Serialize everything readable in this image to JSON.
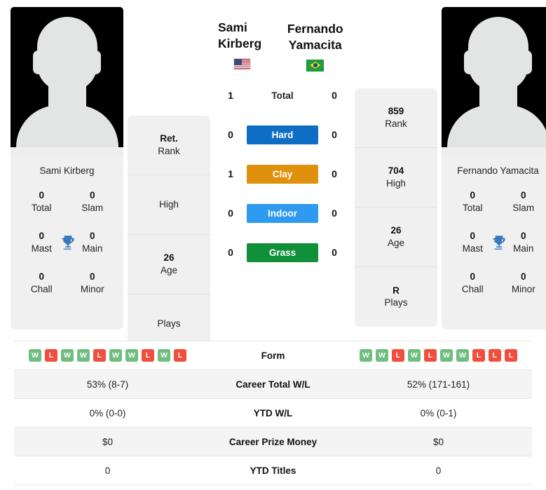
{
  "players": {
    "left": {
      "name": "Sami Kirberg",
      "flag": "us-flag-icon",
      "card_name": "Sami Kirberg",
      "titles": [
        {
          "value": "0",
          "label": "Total"
        },
        {
          "value": "0",
          "label": "Slam"
        },
        {
          "value": "0",
          "label": "Mast"
        },
        {
          "value": "0",
          "label": "Main"
        },
        {
          "value": "0",
          "label": "Chall"
        },
        {
          "value": "0",
          "label": "Minor"
        }
      ],
      "info": [
        {
          "value": "Ret.",
          "label": "Rank"
        },
        {
          "value": "",
          "label": "High"
        },
        {
          "value": "26",
          "label": "Age"
        },
        {
          "value": "",
          "label": "Plays"
        }
      ],
      "form": [
        "W",
        "L",
        "W",
        "W",
        "L",
        "W",
        "W",
        "L",
        "W",
        "L"
      ]
    },
    "right": {
      "name": "Fernando Yamacita",
      "flag": "br-flag-icon",
      "card_name": "Fernando Yamacita",
      "titles": [
        {
          "value": "0",
          "label": "Total"
        },
        {
          "value": "0",
          "label": "Slam"
        },
        {
          "value": "0",
          "label": "Mast"
        },
        {
          "value": "0",
          "label": "Main"
        },
        {
          "value": "0",
          "label": "Chall"
        },
        {
          "value": "0",
          "label": "Minor"
        }
      ],
      "info": [
        {
          "value": "859",
          "label": "Rank"
        },
        {
          "value": "704",
          "label": "High"
        },
        {
          "value": "26",
          "label": "Age"
        },
        {
          "value": "R",
          "label": "Plays"
        }
      ],
      "form": [
        "W",
        "W",
        "L",
        "W",
        "L",
        "W",
        "W",
        "L",
        "L",
        "L"
      ]
    }
  },
  "head_to_head": [
    {
      "label": "Total",
      "left": "1",
      "right": "0",
      "color": ""
    },
    {
      "label": "Hard",
      "left": "0",
      "right": "0",
      "color": "#0d6ec4"
    },
    {
      "label": "Clay",
      "left": "1",
      "right": "0",
      "color": "#df900c"
    },
    {
      "label": "Indoor",
      "left": "0",
      "right": "0",
      "color": "#2e9af0"
    },
    {
      "label": "Grass",
      "left": "0",
      "right": "0",
      "color": "#0f9039"
    }
  ],
  "comparison_rows": [
    {
      "label": "Form",
      "left": "",
      "right": "",
      "type": "form"
    },
    {
      "label": "Career Total W/L",
      "left": "53% (8-7)",
      "right": "52% (171-161)",
      "type": "text"
    },
    {
      "label": "YTD W/L",
      "left": "0% (0-0)",
      "right": "0% (0-1)",
      "type": "text"
    },
    {
      "label": "Career Prize Money",
      "left": "$0",
      "right": "$0",
      "type": "text"
    },
    {
      "label": "YTD Titles",
      "left": "0",
      "right": "0",
      "type": "text"
    }
  ],
  "colors": {
    "win": "#6fbe7f",
    "loss": "#ef4f3c",
    "trophy": "#3a78bd",
    "card_bg": "#f0f0f0"
  }
}
